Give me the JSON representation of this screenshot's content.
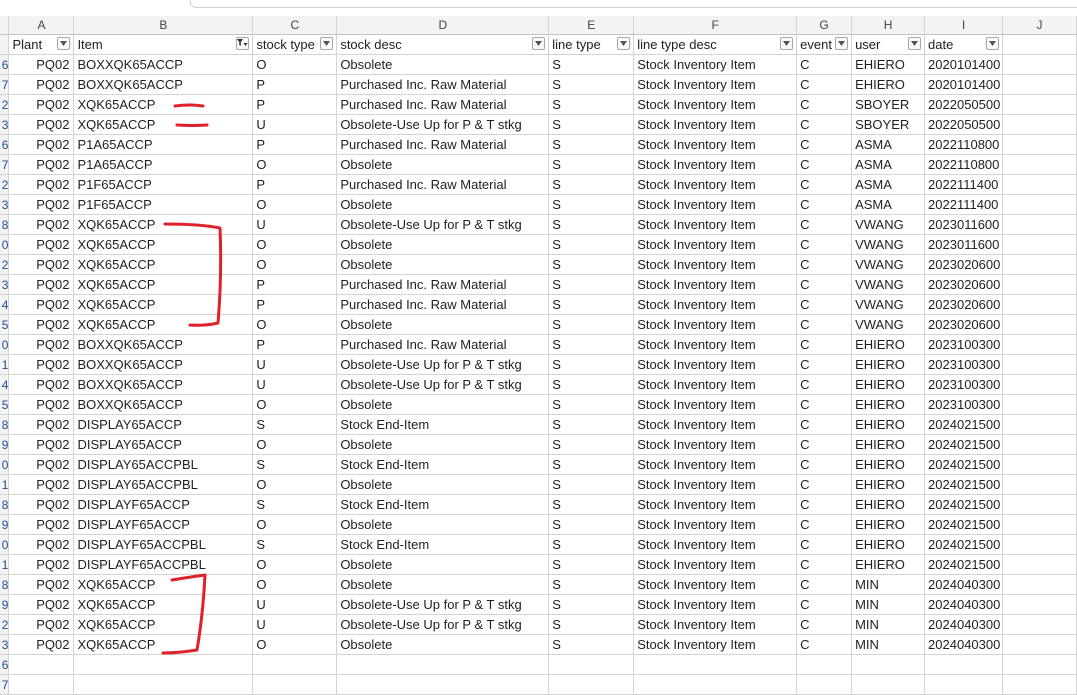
{
  "columns": [
    "A",
    "B",
    "C",
    "D",
    "E",
    "F",
    "G",
    "H",
    "I",
    "J"
  ],
  "headers": {
    "plant": "Plant",
    "item": "Item",
    "stock_type": "stock type",
    "stock_desc": "stock desc",
    "line_type": "line type",
    "line_type_desc": "line type desc",
    "event": "event",
    "user": "user",
    "date": "date"
  },
  "rows": [
    {
      "rn": "6",
      "plant": "PQ02",
      "item": "BOXXQK65ACCP",
      "stock_type": "O",
      "stock_desc": "Obsolete",
      "line_type": "S",
      "line_type_desc": "Stock Inventory Item",
      "event": "C",
      "user": "EHIERO",
      "date": "2020101400"
    },
    {
      "rn": "7",
      "plant": "PQ02",
      "item": "BOXXQK65ACCP",
      "stock_type": "P",
      "stock_desc": "Purchased Inc. Raw Material",
      "line_type": "S",
      "line_type_desc": "Stock Inventory Item",
      "event": "C",
      "user": "EHIERO",
      "date": "2020101400"
    },
    {
      "rn": "2",
      "plant": "PQ02",
      "item": "XQK65ACCP",
      "stock_type": "P",
      "stock_desc": "Purchased Inc. Raw Material",
      "line_type": "S",
      "line_type_desc": "Stock Inventory Item",
      "event": "C",
      "user": "SBOYER",
      "date": "2022050500"
    },
    {
      "rn": "3",
      "plant": "PQ02",
      "item": "XQK65ACCP",
      "stock_type": "U",
      "stock_desc": "Obsolete-Use Up for P & T stkg",
      "line_type": "S",
      "line_type_desc": "Stock Inventory Item",
      "event": "C",
      "user": "SBOYER",
      "date": "2022050500"
    },
    {
      "rn": "6",
      "plant": "PQ02",
      "item": "P1A65ACCP",
      "stock_type": "P",
      "stock_desc": "Purchased Inc. Raw Material",
      "line_type": "S",
      "line_type_desc": "Stock Inventory Item",
      "event": "C",
      "user": "ASMA",
      "date": "2022110800"
    },
    {
      "rn": "7",
      "plant": "PQ02",
      "item": "P1A65ACCP",
      "stock_type": "O",
      "stock_desc": "Obsolete",
      "line_type": "S",
      "line_type_desc": "Stock Inventory Item",
      "event": "C",
      "user": "ASMA",
      "date": "2022110800"
    },
    {
      "rn": "2",
      "plant": "PQ02",
      "item": "P1F65ACCP",
      "stock_type": "P",
      "stock_desc": "Purchased Inc. Raw Material",
      "line_type": "S",
      "line_type_desc": "Stock Inventory Item",
      "event": "C",
      "user": "ASMA",
      "date": "2022111400"
    },
    {
      "rn": "3",
      "plant": "PQ02",
      "item": "P1F65ACCP",
      "stock_type": "O",
      "stock_desc": "Obsolete",
      "line_type": "S",
      "line_type_desc": "Stock Inventory Item",
      "event": "C",
      "user": "ASMA",
      "date": "2022111400"
    },
    {
      "rn": "8",
      "plant": "PQ02",
      "item": "XQK65ACCP",
      "stock_type": "U",
      "stock_desc": "Obsolete-Use Up for P & T stkg",
      "line_type": "S",
      "line_type_desc": "Stock Inventory Item",
      "event": "C",
      "user": "VWANG",
      "date": "2023011600"
    },
    {
      "rn": "0",
      "plant": "PQ02",
      "item": "XQK65ACCP",
      "stock_type": "O",
      "stock_desc": "Obsolete",
      "line_type": "S",
      "line_type_desc": "Stock Inventory Item",
      "event": "C",
      "user": "VWANG",
      "date": "2023011600"
    },
    {
      "rn": "2",
      "plant": "PQ02",
      "item": "XQK65ACCP",
      "stock_type": "O",
      "stock_desc": "Obsolete",
      "line_type": "S",
      "line_type_desc": "Stock Inventory Item",
      "event": "C",
      "user": "VWANG",
      "date": "2023020600"
    },
    {
      "rn": "3",
      "plant": "PQ02",
      "item": "XQK65ACCP",
      "stock_type": "P",
      "stock_desc": "Purchased Inc. Raw Material",
      "line_type": "S",
      "line_type_desc": "Stock Inventory Item",
      "event": "C",
      "user": "VWANG",
      "date": "2023020600"
    },
    {
      "rn": "4",
      "plant": "PQ02",
      "item": "XQK65ACCP",
      "stock_type": "P",
      "stock_desc": "Purchased Inc. Raw Material",
      "line_type": "S",
      "line_type_desc": "Stock Inventory Item",
      "event": "C",
      "user": "VWANG",
      "date": "2023020600"
    },
    {
      "rn": "5",
      "plant": "PQ02",
      "item": "XQK65ACCP",
      "stock_type": "O",
      "stock_desc": "Obsolete",
      "line_type": "S",
      "line_type_desc": "Stock Inventory Item",
      "event": "C",
      "user": "VWANG",
      "date": "2023020600"
    },
    {
      "rn": "0",
      "plant": "PQ02",
      "item": "BOXXQK65ACCP",
      "stock_type": "P",
      "stock_desc": "Purchased Inc. Raw Material",
      "line_type": "S",
      "line_type_desc": "Stock Inventory Item",
      "event": "C",
      "user": "EHIERO",
      "date": "2023100300"
    },
    {
      "rn": "1",
      "plant": "PQ02",
      "item": "BOXXQK65ACCP",
      "stock_type": "U",
      "stock_desc": "Obsolete-Use Up for P & T stkg",
      "line_type": "S",
      "line_type_desc": "Stock Inventory Item",
      "event": "C",
      "user": "EHIERO",
      "date": "2023100300"
    },
    {
      "rn": "4",
      "plant": "PQ02",
      "item": "BOXXQK65ACCP",
      "stock_type": "U",
      "stock_desc": "Obsolete-Use Up for P & T stkg",
      "line_type": "S",
      "line_type_desc": "Stock Inventory Item",
      "event": "C",
      "user": "EHIERO",
      "date": "2023100300"
    },
    {
      "rn": "5",
      "plant": "PQ02",
      "item": "BOXXQK65ACCP",
      "stock_type": "O",
      "stock_desc": "Obsolete",
      "line_type": "S",
      "line_type_desc": "Stock Inventory Item",
      "event": "C",
      "user": "EHIERO",
      "date": "2023100300"
    },
    {
      "rn": "8",
      "plant": "PQ02",
      "item": "DISPLAY65ACCP",
      "stock_type": "S",
      "stock_desc": "Stock End-Item",
      "line_type": "S",
      "line_type_desc": "Stock Inventory Item",
      "event": "C",
      "user": "EHIERO",
      "date": "2024021500"
    },
    {
      "rn": "9",
      "plant": "PQ02",
      "item": "DISPLAY65ACCP",
      "stock_type": "O",
      "stock_desc": "Obsolete",
      "line_type": "S",
      "line_type_desc": "Stock Inventory Item",
      "event": "C",
      "user": "EHIERO",
      "date": "2024021500"
    },
    {
      "rn": "0",
      "plant": "PQ02",
      "item": "DISPLAY65ACCPBL",
      "stock_type": "S",
      "stock_desc": "Stock End-Item",
      "line_type": "S",
      "line_type_desc": "Stock Inventory Item",
      "event": "C",
      "user": "EHIERO",
      "date": "2024021500"
    },
    {
      "rn": "1",
      "plant": "PQ02",
      "item": "DISPLAY65ACCPBL",
      "stock_type": "O",
      "stock_desc": "Obsolete",
      "line_type": "S",
      "line_type_desc": "Stock Inventory Item",
      "event": "C",
      "user": "EHIERO",
      "date": "2024021500"
    },
    {
      "rn": "8",
      "plant": "PQ02",
      "item": "DISPLAYF65ACCP",
      "stock_type": "S",
      "stock_desc": "Stock End-Item",
      "line_type": "S",
      "line_type_desc": "Stock Inventory Item",
      "event": "C",
      "user": "EHIERO",
      "date": "2024021500"
    },
    {
      "rn": "9",
      "plant": "PQ02",
      "item": "DISPLAYF65ACCP",
      "stock_type": "O",
      "stock_desc": "Obsolete",
      "line_type": "S",
      "line_type_desc": "Stock Inventory Item",
      "event": "C",
      "user": "EHIERO",
      "date": "2024021500"
    },
    {
      "rn": "0",
      "plant": "PQ02",
      "item": "DISPLAYF65ACCPBL",
      "stock_type": "S",
      "stock_desc": "Stock End-Item",
      "line_type": "S",
      "line_type_desc": "Stock Inventory Item",
      "event": "C",
      "user": "EHIERO",
      "date": "2024021500"
    },
    {
      "rn": "1",
      "plant": "PQ02",
      "item": "DISPLAYF65ACCPBL",
      "stock_type": "O",
      "stock_desc": "Obsolete",
      "line_type": "S",
      "line_type_desc": "Stock Inventory Item",
      "event": "C",
      "user": "EHIERO",
      "date": "2024021500"
    },
    {
      "rn": "8",
      "plant": "PQ02",
      "item": "XQK65ACCP",
      "stock_type": "O",
      "stock_desc": "Obsolete",
      "line_type": "S",
      "line_type_desc": "Stock Inventory Item",
      "event": "C",
      "user": "MIN",
      "date": "2024040300"
    },
    {
      "rn": "9",
      "plant": "PQ02",
      "item": "XQK65ACCP",
      "stock_type": "U",
      "stock_desc": "Obsolete-Use Up for P & T stkg",
      "line_type": "S",
      "line_type_desc": "Stock Inventory Item",
      "event": "C",
      "user": "MIN",
      "date": "2024040300"
    },
    {
      "rn": "2",
      "plant": "PQ02",
      "item": "XQK65ACCP",
      "stock_type": "U",
      "stock_desc": "Obsolete-Use Up for P & T stkg",
      "line_type": "S",
      "line_type_desc": "Stock Inventory Item",
      "event": "C",
      "user": "MIN",
      "date": "2024040300"
    },
    {
      "rn": "3",
      "plant": "PQ02",
      "item": "XQK65ACCP",
      "stock_type": "O",
      "stock_desc": "Obsolete",
      "line_type": "S",
      "line_type_desc": "Stock Inventory Item",
      "event": "C",
      "user": "MIN",
      "date": "2024040300"
    }
  ],
  "trailing_row_numbers": [
    "6",
    "7"
  ],
  "filter_icon": "dropdown-arrow-icon",
  "active_filter_icon": "filter-funnel-icon",
  "annotation_color": "#e0202a"
}
